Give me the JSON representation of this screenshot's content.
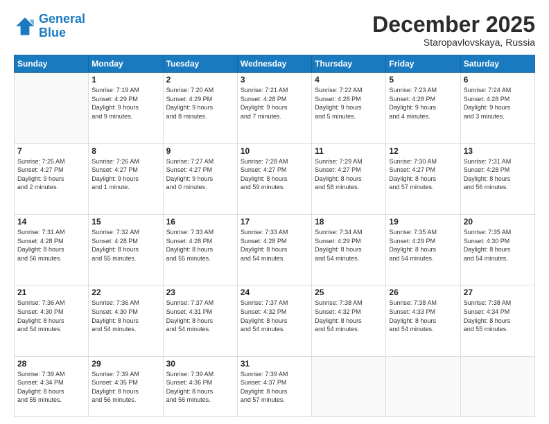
{
  "logo": {
    "line1": "General",
    "line2": "Blue"
  },
  "title": "December 2025",
  "subtitle": "Staropavlovskaya, Russia",
  "days_header": [
    "Sunday",
    "Monday",
    "Tuesday",
    "Wednesday",
    "Thursday",
    "Friday",
    "Saturday"
  ],
  "weeks": [
    [
      {
        "day": "",
        "info": ""
      },
      {
        "day": "1",
        "info": "Sunrise: 7:19 AM\nSunset: 4:29 PM\nDaylight: 9 hours\nand 9 minutes."
      },
      {
        "day": "2",
        "info": "Sunrise: 7:20 AM\nSunset: 4:29 PM\nDaylight: 9 hours\nand 8 minutes."
      },
      {
        "day": "3",
        "info": "Sunrise: 7:21 AM\nSunset: 4:28 PM\nDaylight: 9 hours\nand 7 minutes."
      },
      {
        "day": "4",
        "info": "Sunrise: 7:22 AM\nSunset: 4:28 PM\nDaylight: 9 hours\nand 5 minutes."
      },
      {
        "day": "5",
        "info": "Sunrise: 7:23 AM\nSunset: 4:28 PM\nDaylight: 9 hours\nand 4 minutes."
      },
      {
        "day": "6",
        "info": "Sunrise: 7:24 AM\nSunset: 4:28 PM\nDaylight: 9 hours\nand 3 minutes."
      }
    ],
    [
      {
        "day": "7",
        "info": "Sunrise: 7:25 AM\nSunset: 4:27 PM\nDaylight: 9 hours\nand 2 minutes."
      },
      {
        "day": "8",
        "info": "Sunrise: 7:26 AM\nSunset: 4:27 PM\nDaylight: 9 hours\nand 1 minute."
      },
      {
        "day": "9",
        "info": "Sunrise: 7:27 AM\nSunset: 4:27 PM\nDaylight: 9 hours\nand 0 minutes."
      },
      {
        "day": "10",
        "info": "Sunrise: 7:28 AM\nSunset: 4:27 PM\nDaylight: 8 hours\nand 59 minutes."
      },
      {
        "day": "11",
        "info": "Sunrise: 7:29 AM\nSunset: 4:27 PM\nDaylight: 8 hours\nand 58 minutes."
      },
      {
        "day": "12",
        "info": "Sunrise: 7:30 AM\nSunset: 4:27 PM\nDaylight: 8 hours\nand 57 minutes."
      },
      {
        "day": "13",
        "info": "Sunrise: 7:31 AM\nSunset: 4:28 PM\nDaylight: 8 hours\nand 56 minutes."
      }
    ],
    [
      {
        "day": "14",
        "info": "Sunrise: 7:31 AM\nSunset: 4:28 PM\nDaylight: 8 hours\nand 56 minutes."
      },
      {
        "day": "15",
        "info": "Sunrise: 7:32 AM\nSunset: 4:28 PM\nDaylight: 8 hours\nand 55 minutes."
      },
      {
        "day": "16",
        "info": "Sunrise: 7:33 AM\nSunset: 4:28 PM\nDaylight: 8 hours\nand 55 minutes."
      },
      {
        "day": "17",
        "info": "Sunrise: 7:33 AM\nSunset: 4:28 PM\nDaylight: 8 hours\nand 54 minutes."
      },
      {
        "day": "18",
        "info": "Sunrise: 7:34 AM\nSunset: 4:29 PM\nDaylight: 8 hours\nand 54 minutes."
      },
      {
        "day": "19",
        "info": "Sunrise: 7:35 AM\nSunset: 4:29 PM\nDaylight: 8 hours\nand 54 minutes."
      },
      {
        "day": "20",
        "info": "Sunrise: 7:35 AM\nSunset: 4:30 PM\nDaylight: 8 hours\nand 54 minutes."
      }
    ],
    [
      {
        "day": "21",
        "info": "Sunrise: 7:36 AM\nSunset: 4:30 PM\nDaylight: 8 hours\nand 54 minutes."
      },
      {
        "day": "22",
        "info": "Sunrise: 7:36 AM\nSunset: 4:30 PM\nDaylight: 8 hours\nand 54 minutes."
      },
      {
        "day": "23",
        "info": "Sunrise: 7:37 AM\nSunset: 4:31 PM\nDaylight: 8 hours\nand 54 minutes."
      },
      {
        "day": "24",
        "info": "Sunrise: 7:37 AM\nSunset: 4:32 PM\nDaylight: 8 hours\nand 54 minutes."
      },
      {
        "day": "25",
        "info": "Sunrise: 7:38 AM\nSunset: 4:32 PM\nDaylight: 8 hours\nand 54 minutes."
      },
      {
        "day": "26",
        "info": "Sunrise: 7:38 AM\nSunset: 4:33 PM\nDaylight: 8 hours\nand 54 minutes."
      },
      {
        "day": "27",
        "info": "Sunrise: 7:38 AM\nSunset: 4:34 PM\nDaylight: 8 hours\nand 55 minutes."
      }
    ],
    [
      {
        "day": "28",
        "info": "Sunrise: 7:39 AM\nSunset: 4:34 PM\nDaylight: 8 hours\nand 55 minutes."
      },
      {
        "day": "29",
        "info": "Sunrise: 7:39 AM\nSunset: 4:35 PM\nDaylight: 8 hours\nand 56 minutes."
      },
      {
        "day": "30",
        "info": "Sunrise: 7:39 AM\nSunset: 4:36 PM\nDaylight: 8 hours\nand 56 minutes."
      },
      {
        "day": "31",
        "info": "Sunrise: 7:39 AM\nSunset: 4:37 PM\nDaylight: 8 hours\nand 57 minutes."
      },
      {
        "day": "",
        "info": ""
      },
      {
        "day": "",
        "info": ""
      },
      {
        "day": "",
        "info": ""
      }
    ]
  ]
}
